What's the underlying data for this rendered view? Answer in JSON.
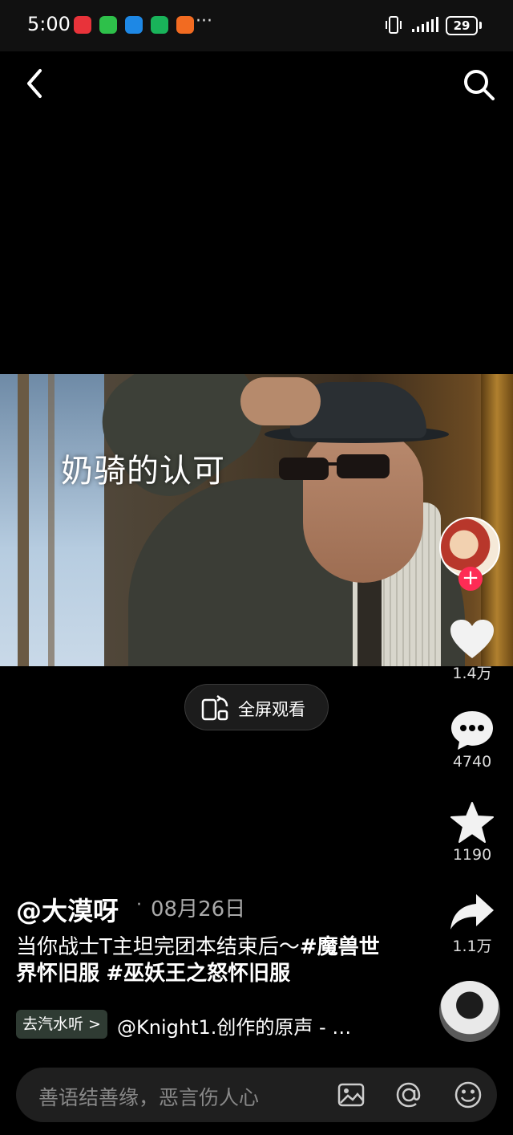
{
  "status_bar": {
    "time": "5:00",
    "more": "···",
    "battery": "29",
    "app_icons": [
      "red-app-icon",
      "wechat-icon",
      "blue-app-icon",
      "green-home-icon",
      "orange-app-icon"
    ]
  },
  "video": {
    "caption": "奶骑的认可"
  },
  "fullscreen": {
    "label": "全屏观看"
  },
  "actions": {
    "likes": "1.4万",
    "comments": "4740",
    "favorites": "1190",
    "shares": "1.1万"
  },
  "post": {
    "author": "@大漠呀",
    "dot": "·",
    "date": "08月26日",
    "desc_text": "当你战士T主坦完团本结束后～",
    "desc_tag1": "#魔兽世界怀旧服",
    "desc_tag2": "#巫妖王之怒怀旧服"
  },
  "music": {
    "tag": "去汽水听 >",
    "text": "@Knight1.创作的原声 - …"
  },
  "comment_bar": {
    "placeholder": "善语结善缘，恶言伤人心"
  },
  "colors": {
    "accent": "#fe2c55",
    "background": "#000000"
  }
}
